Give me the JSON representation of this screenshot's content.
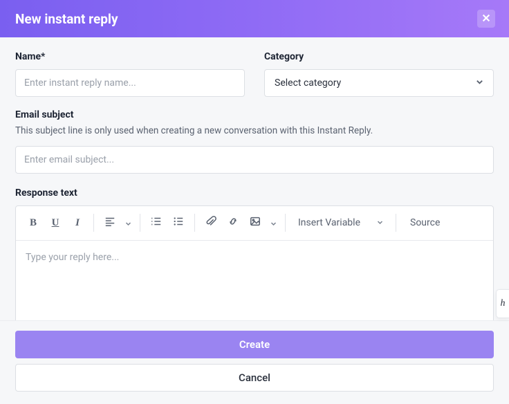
{
  "header": {
    "title": "New instant reply"
  },
  "fields": {
    "name": {
      "label": "Name*",
      "placeholder": "Enter instant reply name...",
      "value": ""
    },
    "category": {
      "label": "Category",
      "selected": "Select category"
    },
    "emailSubject": {
      "label": "Email subject",
      "helper": "This subject line is only used when creating a new conversation with this Instant Reply.",
      "placeholder": "Enter email subject...",
      "value": ""
    },
    "responseText": {
      "label": "Response text",
      "placeholder": "Type your reply here..."
    }
  },
  "toolbar": {
    "insertVariable": "Insert Variable",
    "source": "Source"
  },
  "footer": {
    "create": "Create",
    "cancel": "Cancel"
  },
  "sideWidget": "h"
}
